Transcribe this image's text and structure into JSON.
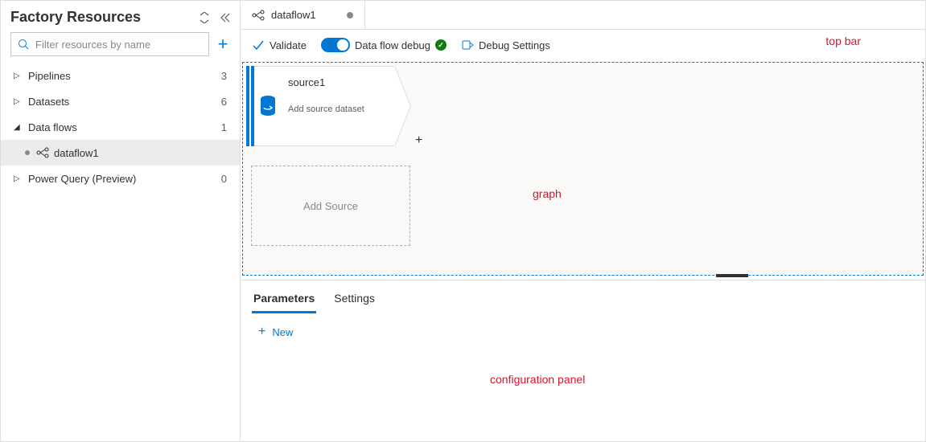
{
  "sidebar": {
    "title": "Factory Resources",
    "filter_placeholder": "Filter resources by name",
    "items": [
      {
        "label": "Pipelines",
        "count": "3",
        "expanded": false
      },
      {
        "label": "Datasets",
        "count": "6",
        "expanded": false
      },
      {
        "label": "Data flows",
        "count": "1",
        "expanded": true
      },
      {
        "label": "Power Query (Preview)",
        "count": "0",
        "expanded": false
      }
    ],
    "dataflow_child": "dataflow1"
  },
  "tabs": [
    {
      "label": "dataflow1",
      "dirty": true
    }
  ],
  "toolbar": {
    "validate": "Validate",
    "debug_label": "Data flow debug",
    "debug_settings": "Debug Settings"
  },
  "overlays": {
    "top_bar": "top bar",
    "graph": "graph",
    "config_panel": "configuration panel"
  },
  "graph": {
    "source_name": "source1",
    "source_sub": "Add source dataset",
    "add_source": "Add Source"
  },
  "config": {
    "tabs": [
      {
        "label": "Parameters",
        "active": true
      },
      {
        "label": "Settings",
        "active": false
      }
    ],
    "new_label": "New"
  }
}
